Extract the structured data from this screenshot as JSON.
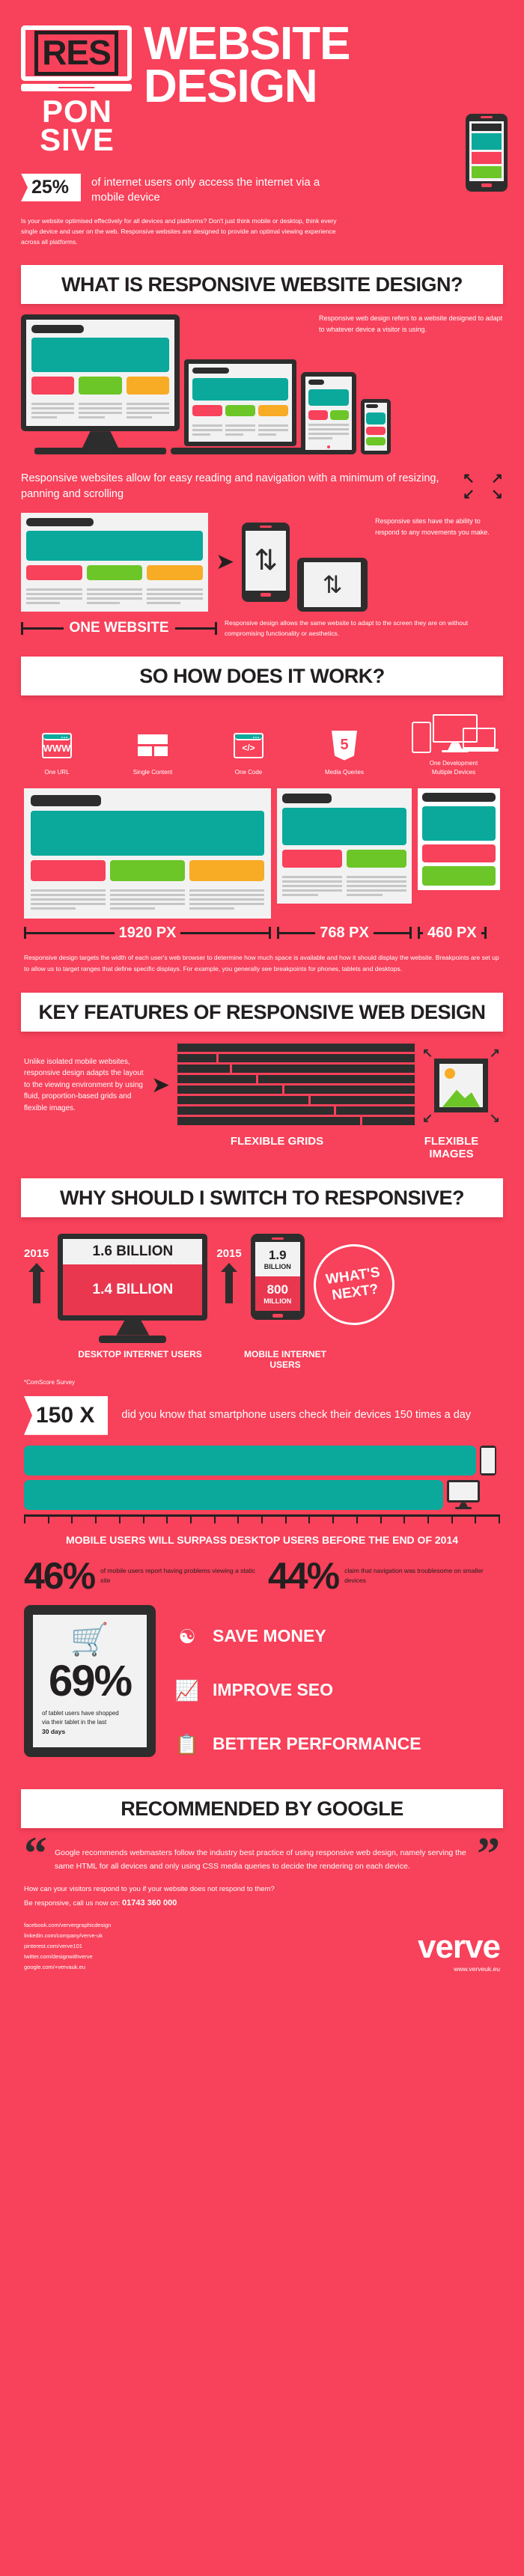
{
  "theme": {
    "brand_red": "#f8415a",
    "dark": "#2d2d2d",
    "teal": "#0aa99c",
    "green": "#6cc627",
    "orange": "#f8ab24",
    "white": "#ffffff"
  },
  "header": {
    "badge_res": "RES",
    "badge_pon": "PON",
    "badge_sive": "SIVE",
    "title_line1": "WEBSITE",
    "title_line2": "DESIGN"
  },
  "stat_banner": {
    "value": "25%",
    "text": "of internet users only access the internet via a mobile device",
    "paragraph": "Is your website optimised effectively for all devices and platforms? Don't just think mobile or desktop, think every single device and user on the web. Responsive websites are designed to provide an optimal viewing experience across all platforms."
  },
  "section_what": {
    "heading": "WHAT IS RESPONSIVE WEBSITE DESIGN?",
    "note": "Responsive web design refers to a website designed to adapt to whatever device a visitor is using.",
    "subtitle": "Responsive websites allow for easy reading and navigation with a minimum of resizing, panning and scrolling",
    "one_website_label": "ONE WEBSITE",
    "phone_note": "Responsive sites have the ability to respond to any movements you make.",
    "one_website_desc": "Responsive design allows the same website to adapt to the screen they are on without compromising functionality or aesthetics."
  },
  "section_how": {
    "heading": "SO HOW DOES IT WORK?",
    "icons": [
      {
        "icon": "browser-www-icon",
        "label": "One URL",
        "glyph": "WWW"
      },
      {
        "icon": "content-blocks-icon",
        "label": "Single Content",
        "glyph": ""
      },
      {
        "icon": "code-window-icon",
        "label": "One Code",
        "glyph": "</>"
      },
      {
        "icon": "html5-shield-icon",
        "label": "Media Queries",
        "glyph": "5"
      },
      {
        "icon": "multi-device-icon",
        "label": "One Development\nMultiple Devices",
        "glyph": ""
      }
    ],
    "icon_label_0": "One URL",
    "icon_label_1": "Single Content",
    "icon_label_2": "One Code",
    "icon_label_3": "Media Queries",
    "icon_label_4a": "One Development",
    "icon_label_4b": "Multiple Devices",
    "breakpoints": [
      "1920 PX",
      "768 PX",
      "460 PX"
    ],
    "bp0": "1920 PX",
    "bp1": "768 PX",
    "bp2": "460 PX",
    "paragraph": "Responsive design targets the width of each user's web browser to determine how much space is available and how it should display the website. Breakpoints are set up to allow us to target ranges that define specific displays. For example, you generally see breakpoints for phones, tablets and desktops."
  },
  "section_features": {
    "heading": "KEY FEATURES OF RESPONSIVE WEB DESIGN",
    "text": "Unlike isolated mobile websites, responsive design adapts the layout to the viewing environment by using fluid, proportion-based grids and flexible images.",
    "caption_grids": "FLEXIBLE GRIDS",
    "caption_images": "FLEXIBLE IMAGES"
  },
  "section_why": {
    "heading": "WHY SHOULD I SWITCH TO RESPONSIVE?",
    "desktop": {
      "year": "2015",
      "top_value": "1.6 BILLION",
      "bottom_value": "1.4 BILLION",
      "caption": "DESKTOP INTERNET USERS"
    },
    "mobile": {
      "year": "2015",
      "top_value": "1.9",
      "top_unit": "BILLION",
      "bottom_value": "800",
      "bottom_unit": "MILLION",
      "caption": "MOBILE INTERNET USERS"
    },
    "whats_next_line1": "WHAT'S",
    "whats_next_line2": "NEXT?",
    "source": "*ComScore Survey"
  },
  "section_150": {
    "value": "150 X",
    "text": "did you know that smartphone users check their devices 150 times a day",
    "caption": "MOBILE USERS WILL SURPASS DESKTOP USERS BEFORE THE END OF 2014"
  },
  "percent_stats": [
    {
      "value": "46%",
      "caption": "of mobile users report having problems viewing a static site"
    },
    {
      "value": "44%",
      "caption": "claim that navigation was troublesome on smaller devices"
    }
  ],
  "pct0_value": "46%",
  "pct0_caption": "of mobile users report having problems viewing a static site",
  "pct1_value": "44%",
  "pct1_caption": "claim that navigation was troublesome on smaller devices",
  "tablet_stat": {
    "icon": "shopping-cart-icon",
    "value": "69%",
    "caption_line1": "of tablet users have shopped",
    "caption_line2": "via their tablet in the last",
    "caption_line3": "30 days"
  },
  "benefits": [
    {
      "icon": "hand-coin-icon",
      "label": "SAVE MONEY",
      "glyph": "✉"
    },
    {
      "icon": "bar-chart-growth-icon",
      "label": "IMPROVE SEO",
      "glyph": "↗"
    },
    {
      "icon": "clipboard-check-icon",
      "label": "BETTER PERFORMANCE",
      "glyph": "✓"
    }
  ],
  "benefit0_label": "SAVE MONEY",
  "benefit1_label": "IMPROVE SEO",
  "benefit2_label": "BETTER PERFORMANCE",
  "section_google": {
    "heading": "RECOMMENDED BY GOOGLE",
    "quote": "Google recommends webmasters follow the industry best practice of using responsive web design, namely serving the same HTML for all devices and only using CSS media queries to decide the rendering on each device.",
    "open_quote": "“",
    "close_quote": "”"
  },
  "cta": {
    "line1": "How can your visitors respond to you if your website does not respond to them?",
    "line2_pre": "Be responsive, call us now on: ",
    "phone": "01743 360 000"
  },
  "footer": {
    "social": [
      "facebook.com/ververgraphicdesign",
      "linkedin.com/company/verve-uk",
      "pinterest.com/verve101",
      "twitter.com/designwithverve",
      "google.com/+vervauk.eu"
    ],
    "s0": "facebook.com/ververgraphicdesign",
    "s1": "linkedin.com/company/verve-uk",
    "s2": "pinterest.com/verve101",
    "s3": "twitter.com/designwithverve",
    "s4": "google.com/+vervauk.eu",
    "brand": "verve",
    "url": "www.verveuk.eu"
  }
}
